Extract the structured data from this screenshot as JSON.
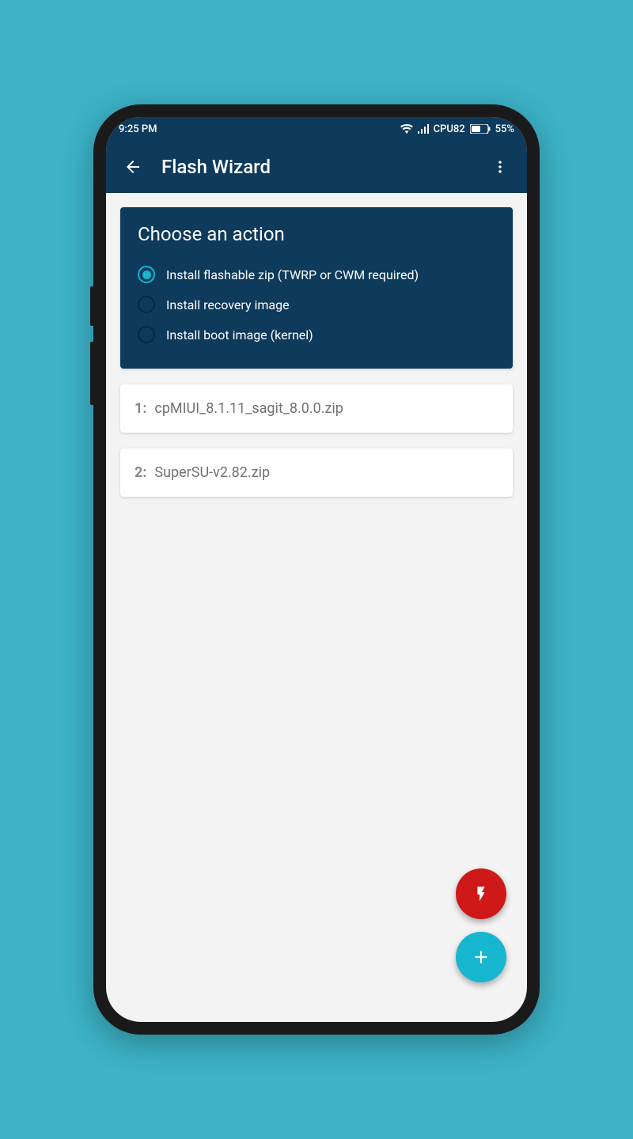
{
  "statusbar": {
    "time": "9:25 PM",
    "cpu": "CPU82",
    "battery": "55%"
  },
  "appbar": {
    "title": "Flash Wizard"
  },
  "action_card": {
    "title": "Choose an action",
    "options": [
      {
        "label": "Install flashable zip (TWRP or CWM required)",
        "selected": true
      },
      {
        "label": "Install recovery image",
        "selected": false
      },
      {
        "label": "Install boot image (kernel)",
        "selected": false
      }
    ]
  },
  "files": [
    {
      "index": "1:",
      "name": "cpMIUI_8.1.11_sagit_8.0.0.zip"
    },
    {
      "index": "2:",
      "name": "SuperSU-v2.82.zip"
    }
  ],
  "colors": {
    "brand": "#0e3a5c",
    "accent": "#16b6cf",
    "danger": "#cf1818",
    "bg": "#3cb3c7"
  }
}
